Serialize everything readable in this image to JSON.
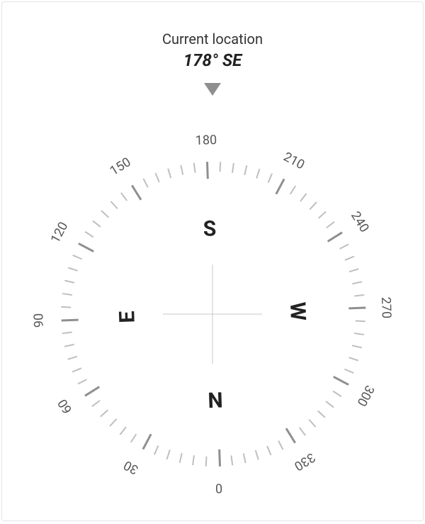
{
  "header": {
    "title": "Current location",
    "bearing_text": "178° SE"
  },
  "compass": {
    "heading_deg": 178,
    "tick_major_every": 30,
    "tick_count": 72,
    "dial_radius": 215,
    "label_radius": 245,
    "cardinal_radius": 120,
    "degree_labels": [
      0,
      30,
      60,
      90,
      120,
      150,
      180,
      210,
      240,
      270,
      300,
      330
    ],
    "cardinals": [
      {
        "label": "N",
        "deg": 0
      },
      {
        "label": "E",
        "deg": 90
      },
      {
        "label": "S",
        "deg": 180
      },
      {
        "label": "W",
        "deg": 270
      }
    ]
  }
}
